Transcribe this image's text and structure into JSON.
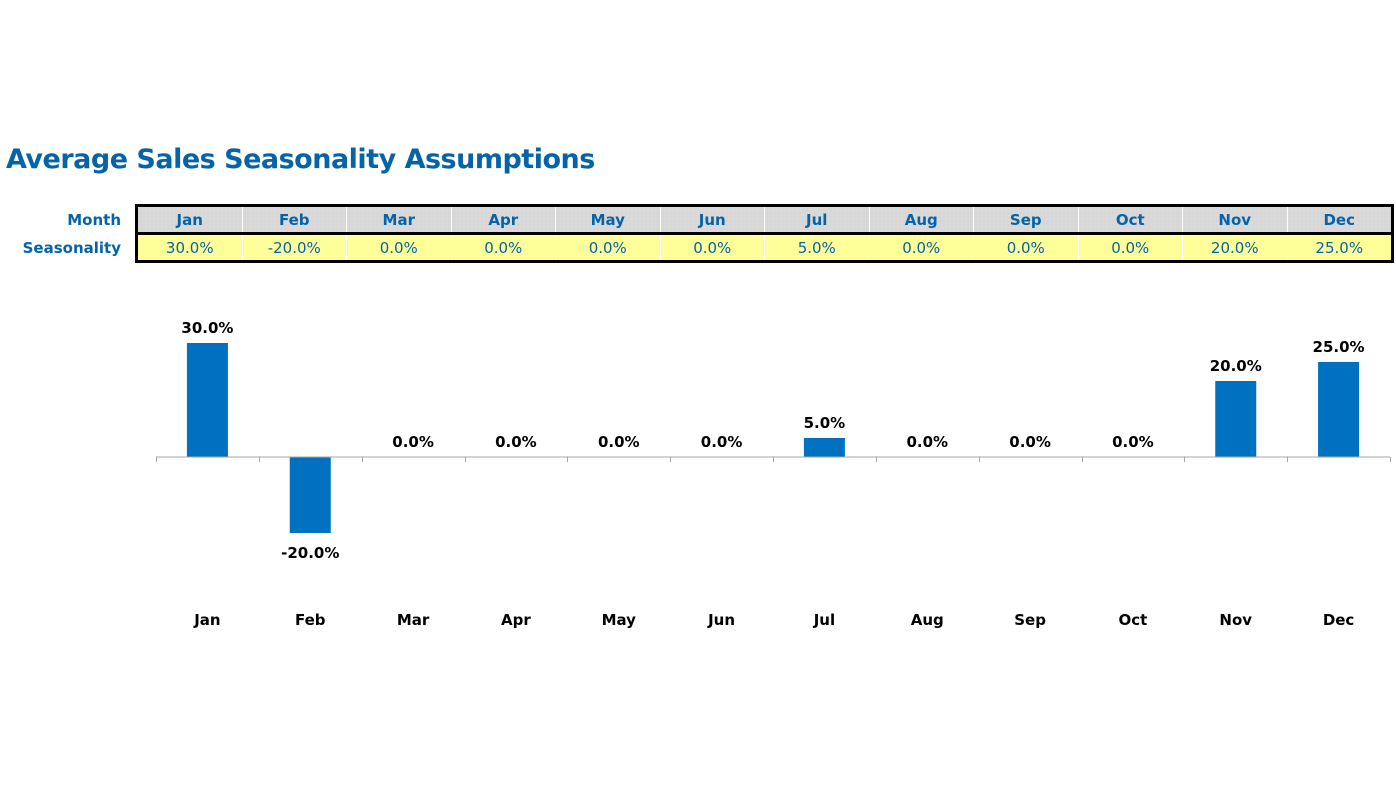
{
  "title": "Average Sales Seasonality Assumptions",
  "table": {
    "row_labels": {
      "month": "Month",
      "seasonality": "Seasonality"
    },
    "months": [
      "Jan",
      "Feb",
      "Mar",
      "Apr",
      "May",
      "Jun",
      "Jul",
      "Aug",
      "Sep",
      "Oct",
      "Nov",
      "Dec"
    ],
    "seasonality": [
      "30.0%",
      "-20.0%",
      "0.0%",
      "0.0%",
      "0.0%",
      "0.0%",
      "5.0%",
      "0.0%",
      "0.0%",
      "0.0%",
      "20.0%",
      "25.0%"
    ]
  },
  "colors": {
    "title": "#0563a8",
    "bar": "#0070c0",
    "header_fill": "#d9d9d9",
    "input_fill": "#ffff99",
    "axis": "#a6a6a6"
  },
  "chart_data": {
    "type": "bar",
    "title": "",
    "xlabel": "",
    "ylabel": "",
    "categories": [
      "Jan",
      "Feb",
      "Mar",
      "Apr",
      "May",
      "Jun",
      "Jul",
      "Aug",
      "Sep",
      "Oct",
      "Nov",
      "Dec"
    ],
    "values": [
      30.0,
      -20.0,
      0.0,
      0.0,
      0.0,
      0.0,
      5.0,
      0.0,
      0.0,
      0.0,
      20.0,
      25.0
    ],
    "data_labels": [
      "30.0%",
      "-20.0%",
      "0.0%",
      "0.0%",
      "0.0%",
      "0.0%",
      "5.0%",
      "0.0%",
      "0.0%",
      "0.0%",
      "20.0%",
      "25.0%"
    ],
    "unit": "%",
    "ylim": [
      -20,
      30
    ],
    "grid": false,
    "legend": "none",
    "category_labels_position": "bottom"
  }
}
